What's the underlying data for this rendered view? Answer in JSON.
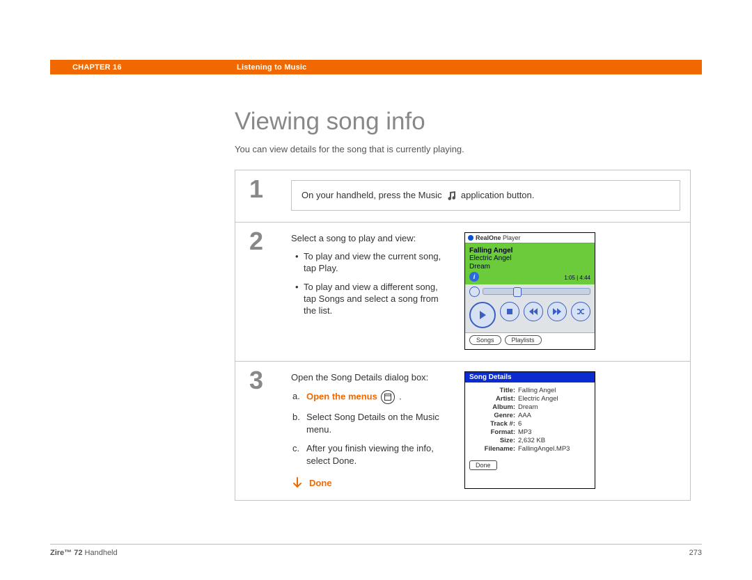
{
  "header": {
    "chapter": "CHAPTER 16",
    "section": "Listening to Music"
  },
  "title": "Viewing song info",
  "intro": "You can view details for the song that is currently playing.",
  "step1": {
    "num": "1",
    "textBefore": "On your handheld, press the Music ",
    "textAfter": " application button."
  },
  "step2": {
    "num": "2",
    "intro": "Select a song to play and view:",
    "bullet1": "To play and view the current song, tap Play.",
    "bullet2": "To play and view a different song, tap Songs and select a song from the list."
  },
  "step3": {
    "num": "3",
    "intro": "Open the Song Details dialog box:",
    "a_letter": "a.",
    "a_text": "Open the menus",
    "b_letter": "b.",
    "b_text": "Select Song Details on the Music menu.",
    "c_letter": "c.",
    "c_text": "After you finish viewing the info, select Done.",
    "done": "Done"
  },
  "player": {
    "brandBold": "RealOne",
    "brandRest": " Player",
    "song1": "Falling Angel",
    "song2": "Electric Angel",
    "song3": "Dream",
    "time": "1:05 | 4:44",
    "tabSongs": "Songs",
    "tabPlaylists": "Playlists"
  },
  "details": {
    "title": "Song Details",
    "rowTitleLbl": "Title:",
    "rowTitleVal": "Falling Angel",
    "rowArtistLbl": "Artist:",
    "rowArtistVal": "Electric Angel",
    "rowAlbumLbl": "Album:",
    "rowAlbumVal": "Dream",
    "rowGenreLbl": "Genre:",
    "rowGenreVal": "AAA",
    "rowTrackLbl": "Track #:",
    "rowTrackVal": "6",
    "rowFormatLbl": "Format:",
    "rowFormatVal": "MP3",
    "rowSizeLbl": "Size:",
    "rowSizeVal": "2,632 KB",
    "rowFileLbl": "Filename:",
    "rowFileVal": "FallingAngel.MP3",
    "doneBtn": "Done"
  },
  "footer": {
    "brand": "Zire™ 72",
    "product": " Handheld",
    "pageNum": "273"
  }
}
